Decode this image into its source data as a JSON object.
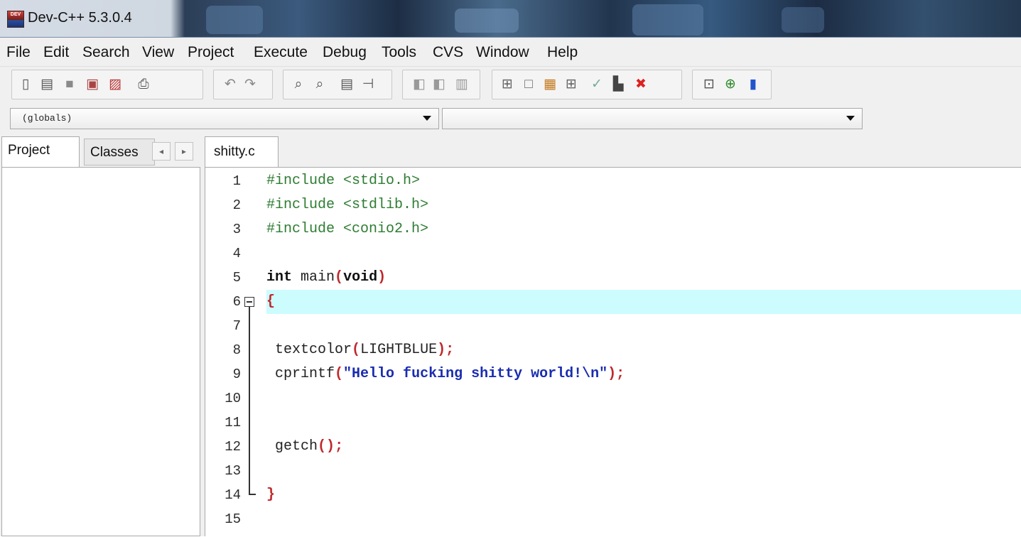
{
  "window": {
    "title": "Dev-C++ 5.3.0.4",
    "app_icon_text": "DEV"
  },
  "menu": [
    "File",
    "Edit",
    "Search",
    "View",
    "Project",
    "Execute",
    "Debug",
    "Tools",
    "CVS",
    "Window",
    "Help"
  ],
  "toolbar": {
    "icons": [
      "new-file-icon",
      "open-file-icon",
      "save-icon",
      "save-all-icon",
      "close-icon",
      "print-icon",
      "undo-icon",
      "redo-icon",
      "find-icon",
      "replace-icon",
      "indent-icon",
      "unindent-icon",
      "toggle-bookmark-icon",
      "goto-bookmark-icon",
      "goto-line-icon",
      "class-browser-icon",
      "new-project-icon",
      "project-options-icon",
      "compiler-options-icon",
      "check-syntax-icon",
      "profile-icon",
      "delete-profile-icon",
      "new-window-icon",
      "add-to-project-icon",
      "remove-from-project-icon"
    ]
  },
  "combos": {
    "scope": "(globals)",
    "members": ""
  },
  "left_panel": {
    "tabs": [
      "Project",
      "Classes"
    ],
    "scroll_left": "◂",
    "scroll_right": "▸"
  },
  "editor": {
    "file_tab": "shitty.c",
    "active_line": 6,
    "lines": [
      {
        "n": "1",
        "text": "#include <stdio.h>"
      },
      {
        "n": "2",
        "text": "#include <stdlib.h>"
      },
      {
        "n": "3",
        "text": "#include <conio2.h>"
      },
      {
        "n": "4",
        "text": ""
      },
      {
        "n": "5",
        "text": "int main(void)"
      },
      {
        "n": "6",
        "text": "{"
      },
      {
        "n": "7",
        "text": ""
      },
      {
        "n": "8",
        "text": " textcolor(LIGHTBLUE);"
      },
      {
        "n": "9",
        "text": " cprintf(\"Hello fucking shitty world!\\n\");"
      },
      {
        "n": "10",
        "text": ""
      },
      {
        "n": "11",
        "text": ""
      },
      {
        "n": "12",
        "text": " getch();"
      },
      {
        "n": "13",
        "text": ""
      },
      {
        "n": "14",
        "text": "}"
      },
      {
        "n": "15",
        "text": ""
      }
    ]
  },
  "colors": {
    "preprocessor": "#2e7d32",
    "string": "#1a2db0",
    "symbol": "#c0282b",
    "active_line_bg": "#cdfcff"
  }
}
